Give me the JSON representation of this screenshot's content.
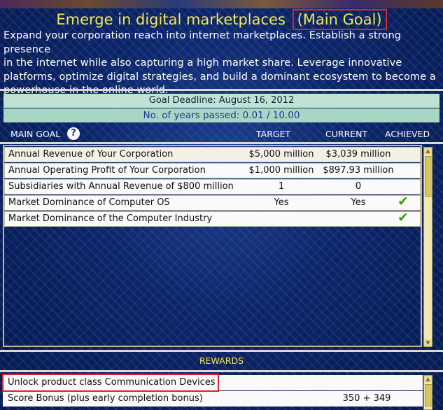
{
  "goal": {
    "title": "Emerge in digital marketplaces",
    "tag": "(Main Goal)",
    "description_lines": [
      "Expand your corporation reach into internet marketplaces. Establish a strong presence",
      "in the internet while also capturing a high market share. Leverage innovative",
      "platforms, optimize digital strategies, and build a dominant ecosystem to become a",
      "powerhouse in the online world."
    ]
  },
  "deadline": "Goal Deadline: August 16, 2012",
  "years_passed": "No. of years passed: 0.01 / 10.00",
  "columns": {
    "main_goal": "MAIN GOAL",
    "target": "TARGET",
    "current": "CURRENT",
    "achieved": "ACHIEVED"
  },
  "rows": [
    {
      "name": "Annual Revenue of Your Corporation",
      "target": "$5,000 million",
      "current": "$3,039 million",
      "achieved": false
    },
    {
      "name": "Annual Operating Profit of Your Corporation",
      "target": "$1,000 million",
      "current": "$897.93 million",
      "achieved": false
    },
    {
      "name": "Subsidiaries with Annual Revenue of $800 million",
      "target": "1",
      "current": "0",
      "achieved": false
    },
    {
      "name": "Market Dominance of Computer OS",
      "target": "Yes",
      "current": "Yes",
      "achieved": true
    },
    {
      "name": "Market Dominance of the Computer Industry",
      "target": "",
      "current": "",
      "achieved": true
    }
  ],
  "check_glyph": "✔",
  "rewards": {
    "title": "REWARDS",
    "items": [
      {
        "name": "Unlock product class Communication Devices",
        "value": ""
      },
      {
        "name": "Score Bonus (plus early completion bonus)",
        "value": "350 + 349"
      }
    ]
  },
  "help_icon": "question-icon",
  "colors": {
    "title_yellow": "#f5e84a",
    "highlight_red": "#e0202a",
    "check_green": "#3aa010",
    "deadline_bg": "#bfe3d2",
    "years_text": "#1a3a9a"
  }
}
